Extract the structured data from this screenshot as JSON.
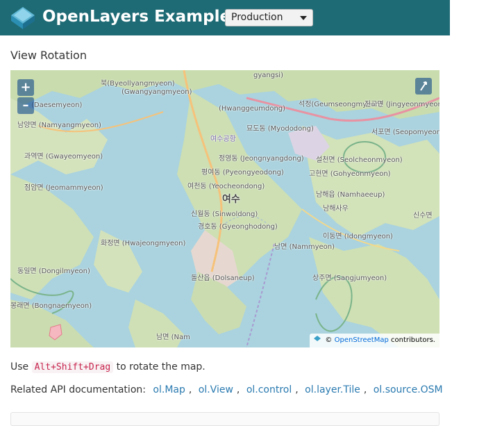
{
  "header": {
    "title": "OpenLayers Examples",
    "version_selected": "Production",
    "background_color": "#1f6b75"
  },
  "page": {
    "title": "View Rotation"
  },
  "map": {
    "zoom_in_label": "+",
    "zoom_out_label": "–",
    "rotate_icon": "rotate-arrow-icon",
    "attribution": {
      "copyright": "©",
      "link": "OpenStreetMap",
      "suffix": "contributors."
    },
    "labels": {
      "gwangyang": "gyangsi)",
      "bukyeon": "북(Byeollyangmyeon)",
      "gwangyangmyeon": "(Gwangyangmyeon)",
      "hwanggeum": "(Hwanggeumdong)",
      "seogjeong": "석정(Geumseongmyeon)",
      "jingyeon": "진교면 (Jingyeonmyeon)",
      "seopo": "서포면 (Seopomyeon)",
      "daesong": "(Daesemyeon)",
      "namyang": "남양면 (Namyangmyeon)",
      "myodo": "묘도동 (Myododong)",
      "yeosu_airport": "여수공항",
      "jeonyang": "정영동 (Jeongnyangdong)",
      "gwayeo": "과역면 (Gwayeomyeon)",
      "seolcheon": "설천면 (Seolcheonmyeon)",
      "gohyeon": "고현면 (Gohyeonmyeon)",
      "pyeongyeo": "평여동 (Pyeongyeodong)",
      "yeocheon": "여천동 (Yeocheondong)",
      "yeosu": "여수",
      "jeomam": "점암면 (Jeomammyeon)",
      "namhae": "남해읍 (Namhaeeup)",
      "namhaesa": "남해사우",
      "sinwol": "신월동 (Sinwoldong)",
      "gyeonghodong": "경호동 (Gyeonghodong)",
      "idong": "이동면 (Idongmyeon)",
      "hwajeong": "화정면 (Hwajeongmyeon)",
      "nammyeon": "남면 (Nammyeon)",
      "dolsan": "돌산읍 (Dolsaneup)",
      "sangju": "상주면 (Sangjumyeon)",
      "dongil": "동일면 (Dongilmyeon)",
      "bongnae": "봉래면 (Bongnaemyeon)",
      "sinsu": "신수면",
      "namm": "남면 (Nam"
    }
  },
  "usage": {
    "prefix": "Use",
    "shortcut": "Alt+Shift+Drag",
    "suffix": "to rotate the map."
  },
  "api": {
    "label": "Related API documentation:",
    "links": [
      "ol.Map",
      "ol.View",
      "ol.control",
      "ol.layer.Tile",
      "ol.source.OSM"
    ]
  }
}
